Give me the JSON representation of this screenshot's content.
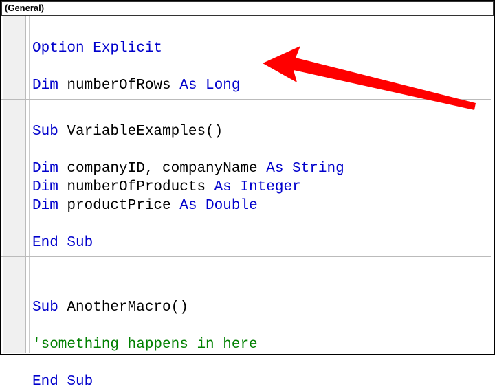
{
  "dropdown": {
    "selected": "(General)"
  },
  "code": {
    "l1a": "Option Explicit",
    "l3a": "Dim",
    "l3b": " numberOfRows ",
    "l3c": "As Long",
    "l5a": "Sub",
    "l5b": " VariableExamples()",
    "l7a": "Dim",
    "l7b": " companyID, companyName ",
    "l7c": "As String",
    "l8a": "Dim",
    "l8b": " numberOfProducts ",
    "l8c": "As Integer",
    "l9a": "Dim",
    "l9b": " productPrice ",
    "l9c": "As Double",
    "l11a": "End Sub",
    "l14a": "Sub",
    "l14b": " AnotherMacro()",
    "l16a": "'something happens in here",
    "l18a": "End Sub"
  },
  "annotation": {
    "arrow_name": "callout-arrow"
  }
}
